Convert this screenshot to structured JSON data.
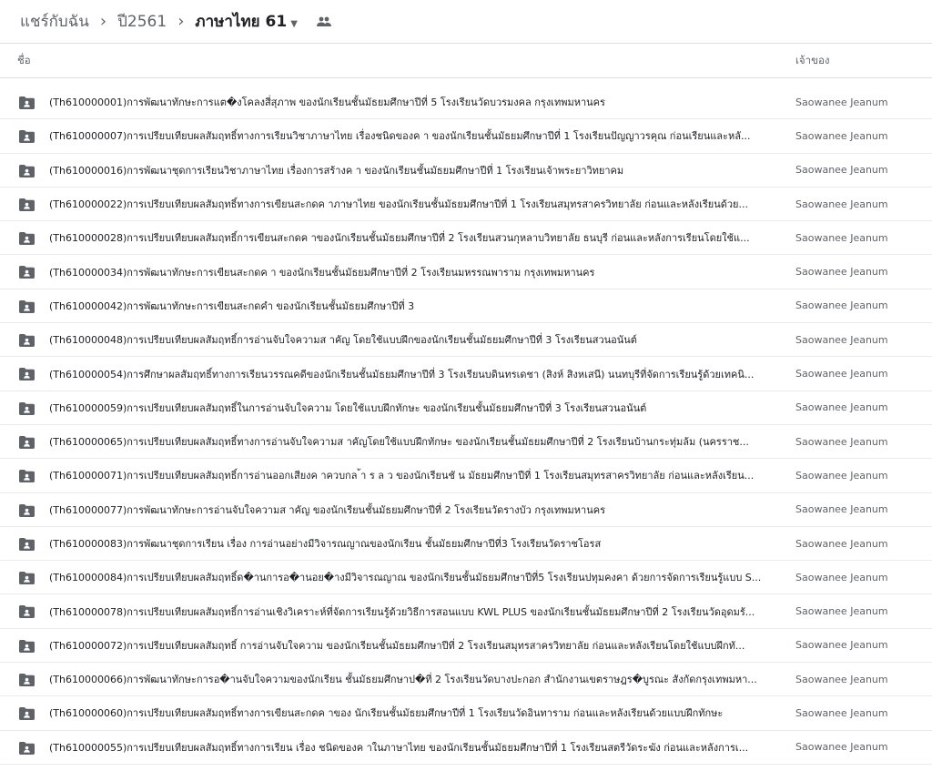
{
  "breadcrumb": {
    "root": "แชร์กับฉัน",
    "separator": "›",
    "level1": "ปี2561",
    "current": "ภาษาไทย 61"
  },
  "columns": {
    "name": "ชื่อ",
    "owner": "เจ้าของ"
  },
  "icons": {
    "folder": "shared-folder-icon",
    "shared": "people-icon",
    "caret": "caret-down-icon"
  },
  "colors": {
    "icon": "#5f6368",
    "selected_bg": "#e8f0fe"
  },
  "files": [
    {
      "name": "(Th610000001)การพัฒนาทักษะการแต�งโคลงสี่สุภาพ  ของนักเรียนชั้นมัธยมศึกษาปีที่ 5 โรงเรียนวัดบวรมงคล กรุงเทพมหานคร",
      "owner": "Saowanee Jeanum"
    },
    {
      "name": "(Th610000007)การเปรียบเทียบผลสัมฤทธิ์ทางการเรียนวิชาภาษาไทย เรื่องชนิดของค า ของนักเรียนชั้นมัธยมศึกษาปีที่ 1 โรงเรียนปัญญาวรคุณ ก่อนเรียนและหลั...",
      "owner": "Saowanee Jeanum"
    },
    {
      "name": "(Th610000016)การพัฒนาชุดการเรียนวิชาภาษาไทย เรื่องการสร้างค า ของนักเรียนชั้นมัธยมศึกษาปีที่ 1 โรงเรียนเจ้าพระยาวิทยาคม",
      "owner": "Saowanee Jeanum"
    },
    {
      "name": "(Th610000022)การเปรียบเทียบผลสัมฤทธิ์ทางการเขียนสะกดค าภาษาไทย ของนักเรียนชั้นมัธยมศึกษาปีที่ 1 โรงเรียนสมุทรสาครวิทยาลัย ก่อนและหลังเรียนด้วย...",
      "owner": "Saowanee Jeanum"
    },
    {
      "name": "(Th610000028)การเปรียบเทียบผลสัมฤทธิ์การเขียนสะกดค าของนักเรียนชั้นมัธยมศึกษาปีที่ 2 โรงเรียนสวนกุหลาบวิทยาลัย ธนบุรี ก่อนและหลังการเรียนโดยใช้แ...",
      "owner": "Saowanee Jeanum"
    },
    {
      "name": "(Th610000034)การพัฒนาทักษะการเขียนสะกดค า ของนักเรียนชั้นมัธยมศึกษาปีที่ 2  โรงเรียนมหรรณพาราม กรุงเทพมหานคร",
      "owner": "Saowanee Jeanum"
    },
    {
      "name": "(Th610000042)การพัฒนาทักษะการเขียนสะกดคำ ของนักเรียนชั้นมัธยมศึกษาปีที่ 3",
      "owner": "Saowanee Jeanum"
    },
    {
      "name": "(Th610000048)การเปรียบเทียบผลสัมฤทธิ์การอ่านจับใจความส าคัญ โดยใช้แบบฝึกของนักเรียนชั้นมัธยมศึกษาปีที่ 3 โรงเรียนสวนอนันต์",
      "owner": "Saowanee Jeanum"
    },
    {
      "name": "(Th610000054)การศึกษาผลสัมฤทธิ์ทางการเรียนวรรณคดีของนักเรียนชั้นมัธยมศึกษาปีที่ 3 โรงเรียนบดินทรเดชา (สิงห์ สิงหเสนี) นนทบุรีที่จัดการเรียนรู้ด้วยเทคนิ...",
      "owner": "Saowanee Jeanum"
    },
    {
      "name": "(Th610000059)การเปรียบเทียบผลสัมฤทธิ์ในการอ่านจับใจความ โดยใช้แบบฝึกทักษะ ของนักเรียนชั้นมัธยมศึกษาปีที่ 3 โรงเรียนสวนอนันต์",
      "owner": "Saowanee Jeanum"
    },
    {
      "name": "(Th610000065)การเปรียบเทียบผลสัมฤทธิ์ทางการอ่านจับใจความส าคัญโดยใช้แบบฝึกทักษะ ของนักเรียนชั้นมัธยมศึกษาปีที่ 2 โรงเรียนบ้านกระทุ่มล้ม (นครราช...",
      "owner": "Saowanee Jeanum"
    },
    {
      "name": "(Th610000071)การเปรียบเทียบผลสัมฤทธิ์การอ่านออกเสียงค าควบกล ้า ร ล ว ของนักเรียนชั น มัธยมศึกษาปีที่ 1 โรงเรียนสมุทรสาครวิทยาลัย  ก่อนและหลังเรียน...",
      "owner": "Saowanee Jeanum"
    },
    {
      "name": "(Th610000077)การพัฒนาทักษะการอ่านจับใจความส าคัญ ของนักเรียนชั้นมัธยมศึกษาปีที่ 2  โรงเรียนวัดรางบัว กรุงเทพมหานคร",
      "owner": "Saowanee Jeanum"
    },
    {
      "name": "(Th610000083)การพัฒนาชุดการเรียน เรื่อง การอ่านอย่างมีวิจารณญาณของนักเรียน  ชั้นมัธยมศึกษาปีที่3 โรงเรียนวัดราชโอรส",
      "owner": "Saowanee Jeanum"
    },
    {
      "name": "(Th610000084)การเปรียบเทียบผลสัมฤทธิ์ด�านการอ�านอย�างมีวิจารณญาณ ของนักเรียนชั้นมัธยมศึกษาปีที่5 โรงเรียนปทุมคงคา  ด้วยการจัดการเรียนรู้แบบ S...",
      "owner": "Saowanee Jeanum"
    },
    {
      "name": "(Th610000078)การเปรียบเทียบผลสัมฤทธิ์การอ่านเชิงวิเคราะห์ที่จัดการเรียนรู้ด้วยวิธีการสอนแบบ KWL PLUS ของนักเรียนชั้นมัธยมศึกษาปีที่ 2 โรงเรียนวัดอุดมรั...",
      "owner": "Saowanee Jeanum"
    },
    {
      "name": "(Th610000072)การเปรียบเทียบผลสัมฤทธิ์  การอ่านจับใจความ ของนักเรียนชั้นมัธยมศึกษาปีที่ 2 โรงเรียนสมุทรสาครวิทยาลัย ก่อนและหลังเรียนโดยใช้แบบฝึกทั...",
      "owner": "Saowanee Jeanum"
    },
    {
      "name": "(Th610000066)การพัฒนาทักษะการอ�านจับใจความของนักเรียน ชั้นมัธยมศึกษาป�ที่ 2  โรงเรียนวัดบางปะกอก สำนักงานเขตราษฎร�บูรณะ สังกัดกรุงเทพมหา...",
      "owner": "Saowanee Jeanum"
    },
    {
      "name": "(Th610000060)การเปรียบเทียบผลสัมฤทธิ์ทางการเขียนสะกดค าของ นักเรียนชั้นมัธยมศึกษาปีที่ 1 โรงเรียนวัดอินทาราม ก่อนและหลังเรียนด้วยแบบฝึกทักษะ",
      "owner": "Saowanee Jeanum"
    },
    {
      "name": "(Th610000055)การเปรียบเทียบผลสัมฤทธิ์ทางการเรียน เรื่อง ชนิดของค าในภาษาไทย  ของนักเรียนชั้นมัธยมศึกษาปีที่ 1 โรงเรียนสตรีวัดระฆัง ก่อนและหลังการเ...",
      "owner": "Saowanee Jeanum"
    }
  ]
}
